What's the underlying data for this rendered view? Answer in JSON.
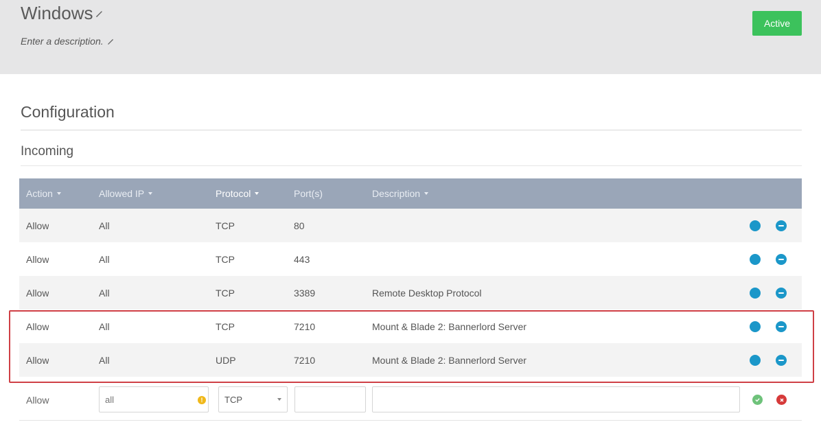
{
  "header": {
    "title": "Windows",
    "description": "Enter a description.",
    "status_badge": "Active"
  },
  "configuration": {
    "title": "Configuration",
    "incoming_title": "Incoming"
  },
  "table": {
    "columns": [
      "Action",
      "Allowed IP",
      "Protocol",
      "Port(s)",
      "Description"
    ],
    "rows": [
      {
        "action": "Allow",
        "ip": "All",
        "protocol": "TCP",
        "ports": "80",
        "description": ""
      },
      {
        "action": "Allow",
        "ip": "All",
        "protocol": "TCP",
        "ports": "443",
        "description": ""
      },
      {
        "action": "Allow",
        "ip": "All",
        "protocol": "TCP",
        "ports": "3389",
        "description": "Remote Desktop Protocol"
      },
      {
        "action": "Allow",
        "ip": "All",
        "protocol": "TCP",
        "ports": "7210",
        "description": "Mount & Blade 2: Bannerlord Server"
      },
      {
        "action": "Allow",
        "ip": "All",
        "protocol": "UDP",
        "ports": "7210",
        "description": "Mount & Blade 2: Bannerlord Server"
      }
    ]
  },
  "new_rule": {
    "action": "Allow",
    "ip_placeholder": "all",
    "warning_glyph": "!",
    "protocol_selected": "TCP",
    "ports_value": "",
    "description_value": ""
  },
  "colors": {
    "header_bg": "#e6e6e7",
    "badge_green": "#3cc25c",
    "table_header": "#9aa6b8",
    "action_blue": "#1b97c9",
    "highlight_red": "#cf3f45",
    "save_green": "#6ec27a",
    "cancel_red": "#d63a3a"
  },
  "icons": {
    "title_edit": "pencil-icon",
    "description_edit": "pencil-icon",
    "row_edit": "compass-edit-icon",
    "row_remove": "minus-circle-icon",
    "ip_warning": "warning-icon",
    "save": "check-circle-icon",
    "cancel": "x-circle-icon"
  }
}
